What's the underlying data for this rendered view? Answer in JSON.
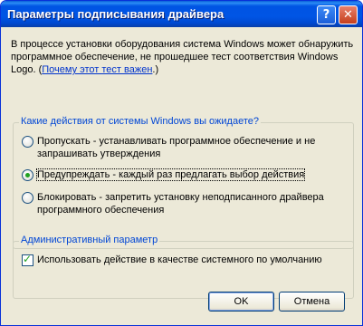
{
  "window": {
    "title": "Параметры подписывания драйвера",
    "help_label": "?",
    "close_label": "✕"
  },
  "intro": {
    "text": "В процессе установки оборудования система Windows может обнаружить программное обеспечение, не прошедшее тест соответствия Windows Logo. (",
    "link": "Почему этот тест важен",
    "tail": ".)"
  },
  "actions_group": {
    "label": "Какие действия от системы Windows вы ожидаете?",
    "options": [
      {
        "label": "Пропускать - устанавливать программное обеспечение и не запрашивать утверждения",
        "checked": false
      },
      {
        "label": "Предупреждать - каждый раз предлагать выбор действия",
        "checked": true
      },
      {
        "label": "Блокировать - запретить установку неподписанного драйвера программного обеспечения",
        "checked": false
      }
    ]
  },
  "admin_group": {
    "label": "Административный параметр",
    "checkbox_label": "Использовать действие в качестве системного по умолчанию",
    "checked": true
  },
  "buttons": {
    "ok": "OK",
    "cancel": "Отмена"
  }
}
